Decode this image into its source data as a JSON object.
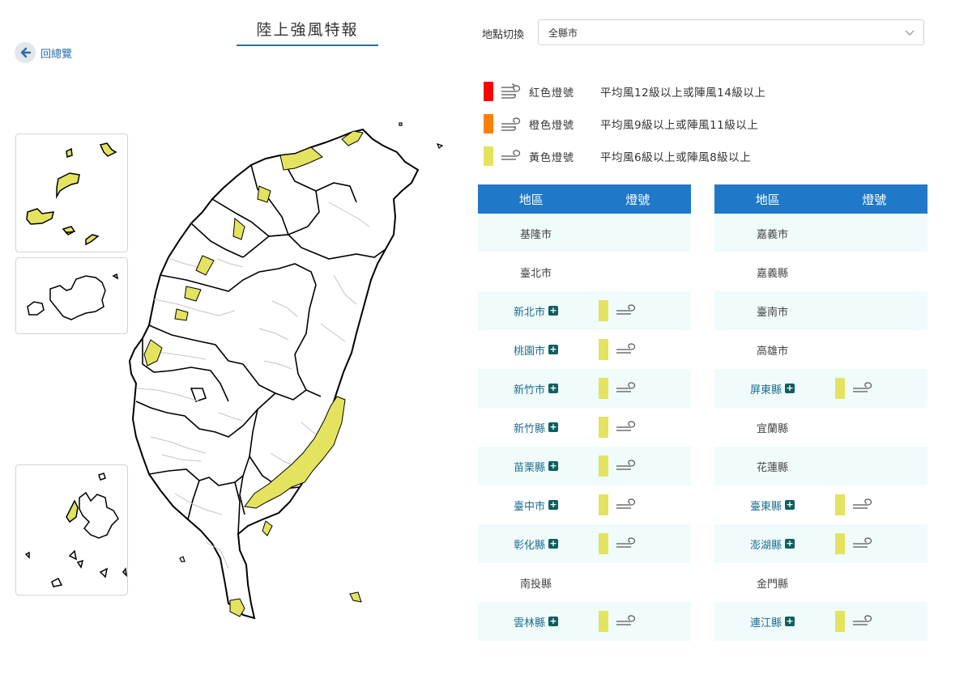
{
  "header": {
    "title": "陸上強風特報",
    "back_label": "回總覽"
  },
  "location": {
    "label": "地點切換",
    "selected": "全縣市"
  },
  "legend": [
    {
      "color": "#ff0000",
      "name": "紅色燈號",
      "desc": "平均風12級以上或陣風14級以上",
      "icon": "wind-strong-icon"
    },
    {
      "color": "#ff8000",
      "name": "橙色燈號",
      "desc": "平均風9級以上或陣風11級以上",
      "icon": "wind-medium-icon"
    },
    {
      "color": "#e3e360",
      "name": "黃色燈號",
      "desc": "平均風6級以上或陣風8級以上",
      "icon": "wind-light-icon"
    }
  ],
  "table_headers": {
    "area": "地區",
    "signal": "燈號"
  },
  "left_table": [
    {
      "area": "基隆市",
      "signal": false
    },
    {
      "area": "臺北市",
      "signal": false
    },
    {
      "area": "新北市",
      "signal": true
    },
    {
      "area": "桃園市",
      "signal": true
    },
    {
      "area": "新竹市",
      "signal": true
    },
    {
      "area": "新竹縣",
      "signal": true
    },
    {
      "area": "苗栗縣",
      "signal": true
    },
    {
      "area": "臺中市",
      "signal": true
    },
    {
      "area": "彰化縣",
      "signal": true
    },
    {
      "area": "南投縣",
      "signal": false
    },
    {
      "area": "雲林縣",
      "signal": true
    }
  ],
  "right_table": [
    {
      "area": "嘉義市",
      "signal": false
    },
    {
      "area": "嘉義縣",
      "signal": false
    },
    {
      "area": "臺南市",
      "signal": false
    },
    {
      "area": "高雄市",
      "signal": false
    },
    {
      "area": "屏東縣",
      "signal": true
    },
    {
      "area": "宜蘭縣",
      "signal": false
    },
    {
      "area": "花蓮縣",
      "signal": false
    },
    {
      "area": "臺東縣",
      "signal": true
    },
    {
      "area": "澎湖縣",
      "signal": true
    },
    {
      "area": "金門縣",
      "signal": false
    },
    {
      "area": "連江縣",
      "signal": true
    }
  ],
  "colors": {
    "header_blue": "#1f78c8",
    "yellow_signal": "#e3e360",
    "row_alt": "#f0fbfc"
  }
}
